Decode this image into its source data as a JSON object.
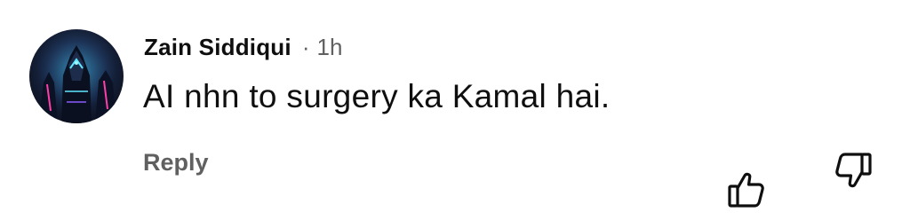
{
  "comment": {
    "author": "Zain Siddiqui",
    "separator": "·",
    "time": "1h",
    "text": "AI nhn to surgery ka Kamal hai.",
    "reply_label": "Reply"
  },
  "icons": {
    "avatar": "profile-avatar",
    "like": "thumbs-up-icon",
    "dislike": "thumbs-down-icon"
  },
  "colors": {
    "text_primary": "#0f0f0f",
    "text_secondary": "#606060",
    "background": "#ffffff"
  }
}
